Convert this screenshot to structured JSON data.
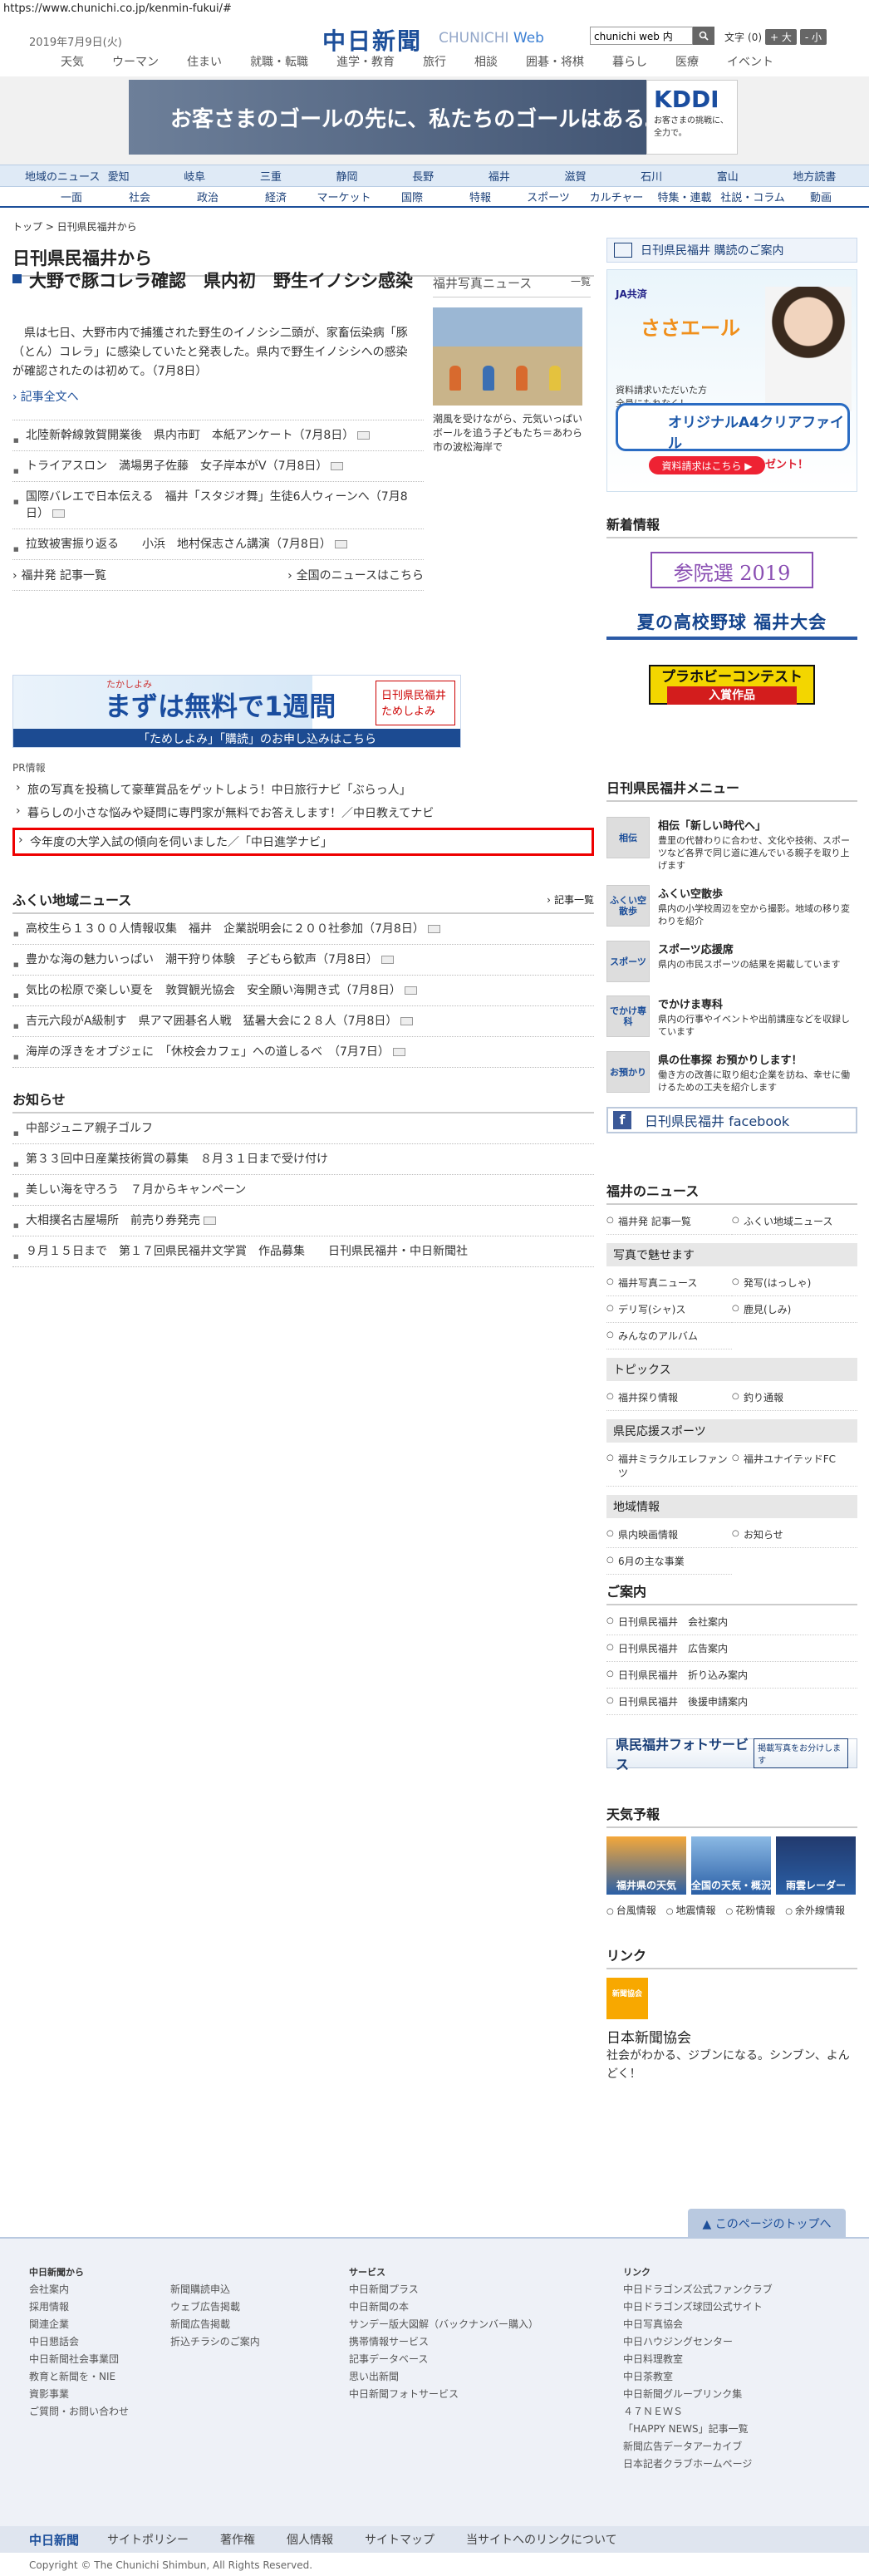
{
  "url": "https://www.chunichi.co.jp/kenmin-fukui/#",
  "header": {
    "date": "2019年7月9日(火)",
    "logo": "中日新聞",
    "logo_sub": "CHUNICHI",
    "logo_web": "Web",
    "search_value": "chunichi web 内",
    "font_label": "文字",
    "font_mid": "(0)",
    "font_big": "+ 大",
    "font_small": "- 小"
  },
  "gnav": [
    "天気",
    "ウーマン",
    "住まい",
    "就職・転職",
    "進学・教育",
    "旅行",
    "相談",
    "囲碁・将棋",
    "暮らし",
    "医療",
    "イベント"
  ],
  "ad_top": {
    "text": "お客さまのゴールの先に、私たちのゴールはある。",
    "brand": "KDDI",
    "brand_sub": "お客さまの挑戦に、全力で。"
  },
  "area_nav": [
    "地域のニュース",
    "愛知",
    "岐阜",
    "三重",
    "静岡",
    "長野",
    "福井",
    "滋賀",
    "石川",
    "富山",
    "地方読書"
  ],
  "cat_nav": [
    "一面",
    "社会",
    "政治",
    "経済",
    "マーケット",
    "国際",
    "特報",
    "スポーツ",
    "カルチャー",
    "特集・連載",
    "社説・コラム",
    "動画"
  ],
  "breadcrumb": "トップ > 日刊県民福井から",
  "page_title": "日刊県民福井から",
  "top": {
    "headline": "大野で豚コレラ確認　県内初　野生イノシシ感染",
    "lead": "県は七日、大野市内で捕獲された野生のイノシシ二頭が、家畜伝染病「豚（とん）コレラ」に感染していたと発表した。県内で野生イノシシへの感染が確認されたのは初めて。（7月8日）",
    "more": "記事全文へ",
    "photo_title": "福井写真ニュース",
    "photo_index": "一覧",
    "photo_caption": "潮風を受けながら、元気いっぱいボールを追う子どもたち＝あわら市の波松海岸で"
  },
  "news_list": [
    "北陸新幹線敦賀開業後　県内市町　本紙アンケート（7月8日）",
    "トライアスロン　満場男子佐藤　女子岸本がV（7月8日）",
    "国際バレエで日本伝える　福井「スタジオ舞」生徒6人ウィーンへ（7月8日）",
    "拉致被害振り返る　　小浜　地村保志さん講演（7月8日）"
  ],
  "sub_links": {
    "left": "福井発 記事一覧",
    "right": "全国のニュースはこちら"
  },
  "promo": {
    "small": "たかしよみ",
    "big": "まずは無料で1週間",
    "right": "日刊県民福井 ためしよみ",
    "bottom": "「ためしよみ」「購読」のお申し込みはこちら"
  },
  "pr": {
    "title": "PR情報",
    "items": [
      "旅の写真を投稿して豪華賞品をゲットしよう！中日旅行ナビ「ぶらっ人」",
      "暮らしの小さな悩みや疑問に専門家が無料でお答えします！／中日教えてナビ",
      "今年度の大学入試の傾向を伺いました／「中日進学ナビ」"
    ]
  },
  "local": {
    "title": "ふくい地域ニュース",
    "index": "記事一覧",
    "items": [
      "高校生ら１３００人情報収集　福井　企業説明会に２００社参加（7月8日）",
      "豊かな海の魅力いっぱい　潮干狩り体験　子どもら歓声（7月8日）",
      "気比の松原で楽しい夏を　敦賀観光協会　安全願い海開き式（7月8日）",
      "吉元六段がA級制す　県アマ囲碁名人戦　猛暑大会に２８人（7月8日）",
      "海岸の浮きをオブジェに　「休校会カフェ」への道しるべ　（7月7日）"
    ]
  },
  "notice": {
    "title": "お知らせ",
    "items": [
      "中部ジュニア親子ゴルフ",
      "第３３回中日産業技術賞の募集　８月３１日まで受け付け",
      "美しい海を守ろう　７月からキャンペーン",
      "大相撲名古屋場所　前売り券発売",
      "９月１５日まで　第１７回県民福井文学賞　作品募集　　日刊県民福井・中日新聞社"
    ]
  },
  "side": {
    "subscribe": "日刊県民福井 購読のご案内",
    "ja_ad": {
      "org": "JA共済",
      "catch": "ささエール",
      "t3": "資料請求いただいた方全員にもれなく！",
      "b1": "オリジナルA4クリアファイル",
      "b2": "抽選で豪華商品プレゼント！",
      "cta": "資料請求はこちら ▶"
    },
    "new_title": "新着情報",
    "sennin": "参院選 2019",
    "baseball": "夏の高校野球 福井大会",
    "plab_top": "プラホビーコンテスト",
    "plab_bottom": "入賞作品",
    "menu_title": "日刊県民福井メニュー",
    "menu": [
      {
        "thumb": "相伝",
        "title": "相伝「新しい時代へ」",
        "desc": "豊里の代替わりに合わせ、文化や技術、スポーツなど各界で同じ道に進んでいる親子を取り上げます"
      },
      {
        "thumb": "ふくい空散歩",
        "title": "ふくい空散歩",
        "desc": "県内の小学校周辺を空から撮影。地域の移り変わりを紹介"
      },
      {
        "thumb": "スポーツ",
        "title": "スポーツ応援席",
        "desc": "県内の市民スポーツの結果を掲載しています"
      },
      {
        "thumb": "でかけ専科",
        "title": "でかけま専科",
        "desc": "県内の行事やイベントや出前講座などを収録しています"
      },
      {
        "thumb": "お預かり",
        "title": "県の仕事探 お預かりします！",
        "desc": "働き方の改善に取り組む企業を訪ね、幸せに働けるための工夫を紹介します"
      }
    ],
    "facebook": "日刊県民福井 facebook",
    "fukui_news_title": "福井のニュース",
    "fukui_news": [
      "福井発 記事一覧",
      "ふくい地域ニュース"
    ],
    "photo_sub": "写真で魅せます",
    "photo_links": [
      "福井写真ニュース",
      "発写(はっしゃ)",
      "デリ写(シャ)ス",
      "鹿見(しみ)",
      "みんなのアルバム"
    ],
    "topics_sub": "トピックス",
    "topics_links": [
      "福井探り情報",
      "釣り通報"
    ],
    "sports_sub": "県民応援スポーツ",
    "sports_links": [
      "福井ミラクルエレファンツ",
      "福井ユナイテッドFC"
    ],
    "local_sub": "地域情報",
    "local_links": [
      "県内映画情報",
      "お知らせ",
      "6月の主な事業"
    ],
    "guide_title": "ご案内",
    "guide_links": [
      "日刊県民福井　会社案内",
      "日刊県民福井　広告案内",
      "日刊県民福井　折り込み案内",
      "日刊県民福井　後援申請案内"
    ],
    "photo_service": "県民福井フォトサービス",
    "photo_service_btn": "掲載写真をお分けします",
    "weather_title": "天気予報",
    "weather": [
      "福井県の天気",
      "全国の天気・概況",
      "雨雲レーダー"
    ],
    "weather_links": [
      "台風情報",
      "地震情報",
      "花粉情報",
      "余外線情報"
    ],
    "link_title": "リンク",
    "link_img": "新聞協会",
    "link_org": "日本新聞協会",
    "link_desc": "社会がわかる、ジブンになる。シンブン、よんどく！"
  },
  "footer": {
    "totop": "このページのトップへ",
    "col1_title": "中日新聞から",
    "col1": [
      "会社案内",
      "採用情報",
      "関連企業",
      "中日懇話会",
      "中日新聞社会事業団",
      "教育と新聞を・NIE",
      "資影事業",
      "ご質問・お問い合わせ"
    ],
    "col2": [
      "新聞購読申込",
      "ウェブ広告掲載",
      "新聞広告掲載",
      "折込チラシのご案内"
    ],
    "col3_title": "サービス",
    "col3": [
      "中日新聞プラス",
      "中日新聞の本",
      "サンデー版大図解（バックナンバー購入）",
      "携帯情報サービス",
      "記事データベース",
      "思い出新聞",
      "中日新聞フォトサービス"
    ],
    "col4_title": "リンク",
    "col4": [
      "中日ドラゴンズ公式ファンクラブ",
      "中日ドラゴンズ球団公式サイト",
      "中日写真協会",
      "中日ハウジングセンター",
      "中日料理教室",
      "中日茶教室",
      "中日新聞グループリンク集",
      "４７ＮＥＷＳ",
      "「HAPPY NEWS」記事一覧",
      "新聞広告データアーカイブ",
      "日本記者クラブホームページ"
    ],
    "bar_logo": "中日新聞",
    "bar": [
      "サイトポリシー",
      "著作権",
      "個人情報",
      "サイトマップ",
      "当サイトへのリンクについて"
    ],
    "copyright": "Copyright © The Chunichi Shimbun, All Rights Reserved."
  }
}
